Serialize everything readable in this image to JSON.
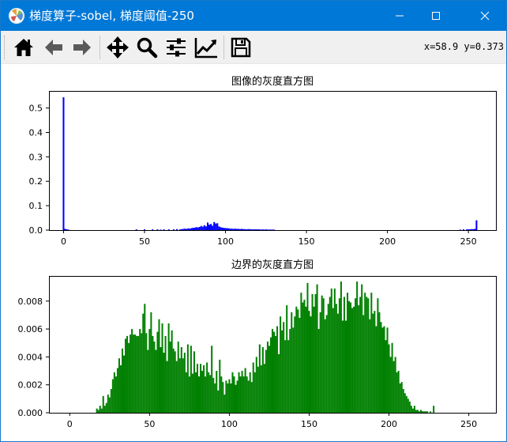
{
  "window": {
    "title": "梯度算子-sobel, 梯度阈值-250",
    "icons": {
      "app": "matplotlib-icon",
      "minimize": "minimize-icon",
      "maximize": "maximize-icon",
      "close": "close-icon"
    }
  },
  "toolbar": {
    "tools": [
      {
        "name": "home",
        "icon": "home-icon"
      },
      {
        "name": "back",
        "icon": "arrow-left-icon"
      },
      {
        "name": "forward",
        "icon": "arrow-right-icon"
      },
      {
        "name": "pan",
        "icon": "move-icon"
      },
      {
        "name": "zoom",
        "icon": "magnifier-icon"
      },
      {
        "name": "subplots",
        "icon": "sliders-icon"
      },
      {
        "name": "customize",
        "icon": "line-chart-icon"
      },
      {
        "name": "save",
        "icon": "floppy-disk-icon"
      }
    ],
    "coordinates": "x=58.9 y=0.373"
  },
  "chart_data": [
    {
      "type": "bar",
      "title": "图像的灰度直方图",
      "color": "#0000ff",
      "xlabel": "",
      "ylabel": "",
      "xlim": [
        -9,
        267
      ],
      "ylim": [
        0,
        0.57
      ],
      "xticks": [
        0,
        50,
        100,
        150,
        200,
        250
      ],
      "xtick_labels": [
        "0",
        "50",
        "100",
        "150",
        "200",
        "250"
      ],
      "yticks": [
        0.0,
        0.1,
        0.2,
        0.3,
        0.4,
        0.5
      ],
      "ytick_labels": [
        "0.0",
        "0.1",
        "0.2",
        "0.3",
        "0.4",
        "0.5"
      ],
      "grid": false,
      "x": [
        0,
        1,
        2,
        3,
        45,
        50,
        55,
        58,
        60,
        62,
        65,
        68,
        70,
        72,
        73,
        74,
        75,
        76,
        77,
        78,
        79,
        80,
        81,
        82,
        83,
        84,
        85,
        86,
        87,
        88,
        89,
        90,
        91,
        92,
        93,
        94,
        95,
        96,
        97,
        98,
        99,
        100,
        101,
        102,
        103,
        104,
        105,
        106,
        107,
        108,
        109,
        110,
        111,
        112,
        113,
        114,
        115,
        116,
        117,
        118,
        119,
        120,
        121,
        122,
        123,
        124,
        125,
        126,
        127,
        128,
        129,
        130,
        245,
        247,
        249,
        250,
        251,
        252,
        253,
        254,
        255
      ],
      "values": [
        0.544,
        0.005,
        0.003,
        0.002,
        0.003,
        0.003,
        0.003,
        0.003,
        0.002,
        0.003,
        0.003,
        0.003,
        0.004,
        0.003,
        0.004,
        0.005,
        0.006,
        0.005,
        0.007,
        0.006,
        0.008,
        0.009,
        0.01,
        0.012,
        0.011,
        0.013,
        0.017,
        0.014,
        0.02,
        0.015,
        0.031,
        0.022,
        0.025,
        0.018,
        0.033,
        0.027,
        0.028,
        0.015,
        0.012,
        0.01,
        0.009,
        0.008,
        0.008,
        0.007,
        0.006,
        0.006,
        0.005,
        0.006,
        0.005,
        0.005,
        0.004,
        0.005,
        0.004,
        0.004,
        0.003,
        0.004,
        0.004,
        0.003,
        0.003,
        0.003,
        0.003,
        0.003,
        0.003,
        0.002,
        0.003,
        0.002,
        0.003,
        0.002,
        0.002,
        0.002,
        0.002,
        0.002,
        0.002,
        0.003,
        0.003,
        0.003,
        0.003,
        0.004,
        0.004,
        0.005,
        0.04
      ]
    },
    {
      "type": "bar",
      "title": "边界的灰度直方图",
      "color": "#008000",
      "xlabel": "",
      "ylabel": "",
      "xlim": [
        -13,
        267
      ],
      "ylim": [
        0,
        0.0098
      ],
      "xticks": [
        0,
        50,
        100,
        150,
        200,
        250
      ],
      "xtick_labels": [
        "0",
        "50",
        "100",
        "150",
        "200",
        "250"
      ],
      "yticks": [
        0.0,
        0.002,
        0.004,
        0.006,
        0.008
      ],
      "ytick_labels": [
        "0.000",
        "0.002",
        "0.004",
        "0.006",
        "0.008"
      ],
      "grid": false,
      "x_start": 17,
      "values": [
        0.0003,
        0.0002,
        0.0005,
        0.0003,
        0.0012,
        0.0005,
        0.0007,
        0.0013,
        0.0011,
        0.0017,
        0.0024,
        0.0029,
        0.0026,
        0.0032,
        0.0039,
        0.0034,
        0.0046,
        0.0041,
        0.0053,
        0.0055,
        0.005,
        0.0056,
        0.006,
        0.0056,
        0.0056,
        0.0055,
        0.0055,
        0.006,
        0.0057,
        0.0071,
        0.0078,
        0.0057,
        0.0045,
        0.006,
        0.0072,
        0.0055,
        0.0051,
        0.0045,
        0.0058,
        0.0067,
        0.0047,
        0.0064,
        0.0043,
        0.0055,
        0.0037,
        0.0064,
        0.0051,
        0.0059,
        0.0046,
        0.0044,
        0.0037,
        0.0051,
        0.0039,
        0.0047,
        0.0039,
        0.0043,
        0.0029,
        0.0049,
        0.0026,
        0.0048,
        0.0028,
        0.0044,
        0.0029,
        0.0035,
        0.0026,
        0.0035,
        0.003,
        0.0034,
        0.0026,
        0.0036,
        0.0029,
        0.0027,
        0.0048,
        0.0025,
        0.0021,
        0.003,
        0.0016,
        0.0038,
        0.0026,
        0.0022,
        0.0013,
        0.0023,
        0.0021,
        0.0024,
        0.0021,
        0.0029,
        0.0026,
        0.002,
        0.0023,
        0.0029,
        0.0026,
        0.003,
        0.0026,
        0.0032,
        0.0026,
        0.0023,
        0.0029,
        0.0022,
        0.0036,
        0.0029,
        0.004,
        0.0033,
        0.0049,
        0.0034,
        0.0047,
        0.0035,
        0.0045,
        0.0051,
        0.0048,
        0.0054,
        0.006,
        0.0058,
        0.0055,
        0.0062,
        0.0042,
        0.0069,
        0.0059,
        0.0065,
        0.0052,
        0.0077,
        0.0052,
        0.006,
        0.0072,
        0.0061,
        0.0069,
        0.0076,
        0.0074,
        0.0068,
        0.0086,
        0.0079,
        0.0081,
        0.0076,
        0.0093,
        0.0073,
        0.0069,
        0.0085,
        0.0076,
        0.0085,
        0.0092,
        0.006,
        0.0072,
        0.0084,
        0.0082,
        0.0067,
        0.007,
        0.0078,
        0.0083,
        0.0089,
        0.0075,
        0.0089,
        0.0078,
        0.0071,
        0.0082,
        0.0094,
        0.0066,
        0.0083,
        0.0066,
        0.0086,
        0.008,
        0.0079,
        0.0075,
        0.0076,
        0.0082,
        0.0094,
        0.0077,
        0.0083,
        0.0092,
        0.007,
        0.0086,
        0.0083,
        0.0082,
        0.0067,
        0.0086,
        0.0071,
        0.0073,
        0.0062,
        0.0082,
        0.0072,
        0.0065,
        0.0061,
        0.0062,
        0.0052,
        0.0061,
        0.0049,
        0.004,
        0.005,
        0.0037,
        0.004,
        0.0029,
        0.003,
        0.0021,
        0.0022,
        0.0017,
        0.0014,
        0.0012,
        0.001,
        0.0008,
        0.0005,
        0.0003,
        0.0005,
        0.0002,
        0.0002,
        0.0001,
        0.0002,
        0.0001,
        0.0001,
        0.0001,
        0.0001,
        0.0,
        0.0001,
        0.0,
        0.0005
      ]
    }
  ]
}
